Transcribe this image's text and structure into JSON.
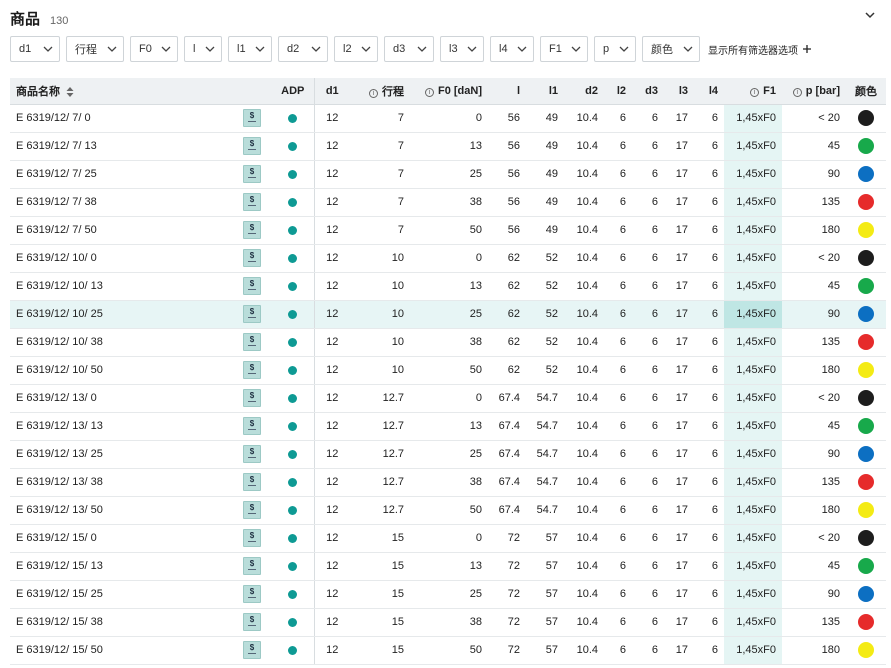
{
  "header": {
    "title": "商品",
    "count": "130"
  },
  "filters": [
    {
      "label": "d1",
      "w": 50
    },
    {
      "label": "行程",
      "w": 58
    },
    {
      "label": "F0",
      "w": 48
    },
    {
      "label": "l",
      "w": 38
    },
    {
      "label": "l1",
      "w": 44
    },
    {
      "label": "d2",
      "w": 50
    },
    {
      "label": "l2",
      "w": 44
    },
    {
      "label": "d3",
      "w": 50
    },
    {
      "label": "l3",
      "w": 44
    },
    {
      "label": "l4",
      "w": 44
    },
    {
      "label": "F1",
      "w": 48
    },
    {
      "label": "p",
      "w": 42
    },
    {
      "label": "颜色",
      "w": 58
    }
  ],
  "show_all_filters": "显示所有筛选器选项",
  "columns": [
    {
      "key": "name",
      "label": "商品名称",
      "align": "l",
      "sort": true
    },
    {
      "key": "thumb",
      "label": "",
      "align": "c"
    },
    {
      "key": "adp",
      "label": "ADP",
      "align": "c"
    },
    {
      "key": "d1",
      "label": "d1",
      "align": "c"
    },
    {
      "key": "stroke",
      "label": "行程",
      "align": "r",
      "info": true
    },
    {
      "key": "f0",
      "label": "F0 [daN]",
      "align": "r",
      "info": true
    },
    {
      "key": "l",
      "label": "l",
      "align": "r"
    },
    {
      "key": "l1",
      "label": "l1",
      "align": "r"
    },
    {
      "key": "d2",
      "label": "d2",
      "align": "r"
    },
    {
      "key": "l2",
      "label": "l2",
      "align": "r"
    },
    {
      "key": "d3",
      "label": "d3",
      "align": "r"
    },
    {
      "key": "l3",
      "label": "l3",
      "align": "r"
    },
    {
      "key": "l4",
      "label": "l4",
      "align": "r"
    },
    {
      "key": "f1",
      "label": "F1",
      "align": "r",
      "info": true
    },
    {
      "key": "p",
      "label": "p [bar]",
      "align": "r",
      "info": true
    },
    {
      "key": "color",
      "label": "颜色",
      "align": "c"
    }
  ],
  "colors": {
    "black": "#1d1d1d",
    "green": "#18a94b",
    "blue": "#0c6fc2",
    "red": "#e62b2b",
    "yellow": "#f4eb14",
    "teal": "#0e9a94"
  },
  "highlighted_row": 7,
  "rows": [
    {
      "name": "E 6319/12/ 7/ 0",
      "d1": "12",
      "stroke": "7",
      "f0": "0",
      "l": "56",
      "l1": "49",
      "d2": "10.4",
      "l2": "6",
      "d3": "6",
      "l3": "17",
      "l4": "6",
      "f1": "1,45xF0",
      "p": "< 20",
      "color": "black"
    },
    {
      "name": "E 6319/12/ 7/ 13",
      "d1": "12",
      "stroke": "7",
      "f0": "13",
      "l": "56",
      "l1": "49",
      "d2": "10.4",
      "l2": "6",
      "d3": "6",
      "l3": "17",
      "l4": "6",
      "f1": "1,45xF0",
      "p": "45",
      "color": "green"
    },
    {
      "name": "E 6319/12/ 7/ 25",
      "d1": "12",
      "stroke": "7",
      "f0": "25",
      "l": "56",
      "l1": "49",
      "d2": "10.4",
      "l2": "6",
      "d3": "6",
      "l3": "17",
      "l4": "6",
      "f1": "1,45xF0",
      "p": "90",
      "color": "blue"
    },
    {
      "name": "E 6319/12/ 7/ 38",
      "d1": "12",
      "stroke": "7",
      "f0": "38",
      "l": "56",
      "l1": "49",
      "d2": "10.4",
      "l2": "6",
      "d3": "6",
      "l3": "17",
      "l4": "6",
      "f1": "1,45xF0",
      "p": "135",
      "color": "red"
    },
    {
      "name": "E 6319/12/ 7/ 50",
      "d1": "12",
      "stroke": "7",
      "f0": "50",
      "l": "56",
      "l1": "49",
      "d2": "10.4",
      "l2": "6",
      "d3": "6",
      "l3": "17",
      "l4": "6",
      "f1": "1,45xF0",
      "p": "180",
      "color": "yellow"
    },
    {
      "name": "E 6319/12/ 10/ 0",
      "d1": "12",
      "stroke": "10",
      "f0": "0",
      "l": "62",
      "l1": "52",
      "d2": "10.4",
      "l2": "6",
      "d3": "6",
      "l3": "17",
      "l4": "6",
      "f1": "1,45xF0",
      "p": "< 20",
      "color": "black"
    },
    {
      "name": "E 6319/12/ 10/ 13",
      "d1": "12",
      "stroke": "10",
      "f0": "13",
      "l": "62",
      "l1": "52",
      "d2": "10.4",
      "l2": "6",
      "d3": "6",
      "l3": "17",
      "l4": "6",
      "f1": "1,45xF0",
      "p": "45",
      "color": "green"
    },
    {
      "name": "E 6319/12/ 10/ 25",
      "d1": "12",
      "stroke": "10",
      "f0": "25",
      "l": "62",
      "l1": "52",
      "d2": "10.4",
      "l2": "6",
      "d3": "6",
      "l3": "17",
      "l4": "6",
      "f1": "1,45xF0",
      "p": "90",
      "color": "blue"
    },
    {
      "name": "E 6319/12/ 10/ 38",
      "d1": "12",
      "stroke": "10",
      "f0": "38",
      "l": "62",
      "l1": "52",
      "d2": "10.4",
      "l2": "6",
      "d3": "6",
      "l3": "17",
      "l4": "6",
      "f1": "1,45xF0",
      "p": "135",
      "color": "red"
    },
    {
      "name": "E 6319/12/ 10/ 50",
      "d1": "12",
      "stroke": "10",
      "f0": "50",
      "l": "62",
      "l1": "52",
      "d2": "10.4",
      "l2": "6",
      "d3": "6",
      "l3": "17",
      "l4": "6",
      "f1": "1,45xF0",
      "p": "180",
      "color": "yellow"
    },
    {
      "name": "E 6319/12/ 13/ 0",
      "d1": "12",
      "stroke": "12.7",
      "f0": "0",
      "l": "67.4",
      "l1": "54.7",
      "d2": "10.4",
      "l2": "6",
      "d3": "6",
      "l3": "17",
      "l4": "6",
      "f1": "1,45xF0",
      "p": "< 20",
      "color": "black"
    },
    {
      "name": "E 6319/12/ 13/ 13",
      "d1": "12",
      "stroke": "12.7",
      "f0": "13",
      "l": "67.4",
      "l1": "54.7",
      "d2": "10.4",
      "l2": "6",
      "d3": "6",
      "l3": "17",
      "l4": "6",
      "f1": "1,45xF0",
      "p": "45",
      "color": "green"
    },
    {
      "name": "E 6319/12/ 13/ 25",
      "d1": "12",
      "stroke": "12.7",
      "f0": "25",
      "l": "67.4",
      "l1": "54.7",
      "d2": "10.4",
      "l2": "6",
      "d3": "6",
      "l3": "17",
      "l4": "6",
      "f1": "1,45xF0",
      "p": "90",
      "color": "blue"
    },
    {
      "name": "E 6319/12/ 13/ 38",
      "d1": "12",
      "stroke": "12.7",
      "f0": "38",
      "l": "67.4",
      "l1": "54.7",
      "d2": "10.4",
      "l2": "6",
      "d3": "6",
      "l3": "17",
      "l4": "6",
      "f1": "1,45xF0",
      "p": "135",
      "color": "red"
    },
    {
      "name": "E 6319/12/ 13/ 50",
      "d1": "12",
      "stroke": "12.7",
      "f0": "50",
      "l": "67.4",
      "l1": "54.7",
      "d2": "10.4",
      "l2": "6",
      "d3": "6",
      "l3": "17",
      "l4": "6",
      "f1": "1,45xF0",
      "p": "180",
      "color": "yellow"
    },
    {
      "name": "E 6319/12/ 15/ 0",
      "d1": "12",
      "stroke": "15",
      "f0": "0",
      "l": "72",
      "l1": "57",
      "d2": "10.4",
      "l2": "6",
      "d3": "6",
      "l3": "17",
      "l4": "6",
      "f1": "1,45xF0",
      "p": "< 20",
      "color": "black"
    },
    {
      "name": "E 6319/12/ 15/ 13",
      "d1": "12",
      "stroke": "15",
      "f0": "13",
      "l": "72",
      "l1": "57",
      "d2": "10.4",
      "l2": "6",
      "d3": "6",
      "l3": "17",
      "l4": "6",
      "f1": "1,45xF0",
      "p": "45",
      "color": "green"
    },
    {
      "name": "E 6319/12/ 15/ 25",
      "d1": "12",
      "stroke": "15",
      "f0": "25",
      "l": "72",
      "l1": "57",
      "d2": "10.4",
      "l2": "6",
      "d3": "6",
      "l3": "17",
      "l4": "6",
      "f1": "1,45xF0",
      "p": "90",
      "color": "blue"
    },
    {
      "name": "E 6319/12/ 15/ 38",
      "d1": "12",
      "stroke": "15",
      "f0": "38",
      "l": "72",
      "l1": "57",
      "d2": "10.4",
      "l2": "6",
      "d3": "6",
      "l3": "17",
      "l4": "6",
      "f1": "1,45xF0",
      "p": "135",
      "color": "red"
    },
    {
      "name": "E 6319/12/ 15/ 50",
      "d1": "12",
      "stroke": "15",
      "f0": "50",
      "l": "72",
      "l1": "57",
      "d2": "10.4",
      "l2": "6",
      "d3": "6",
      "l3": "17",
      "l4": "6",
      "f1": "1,45xF0",
      "p": "180",
      "color": "yellow"
    }
  ]
}
